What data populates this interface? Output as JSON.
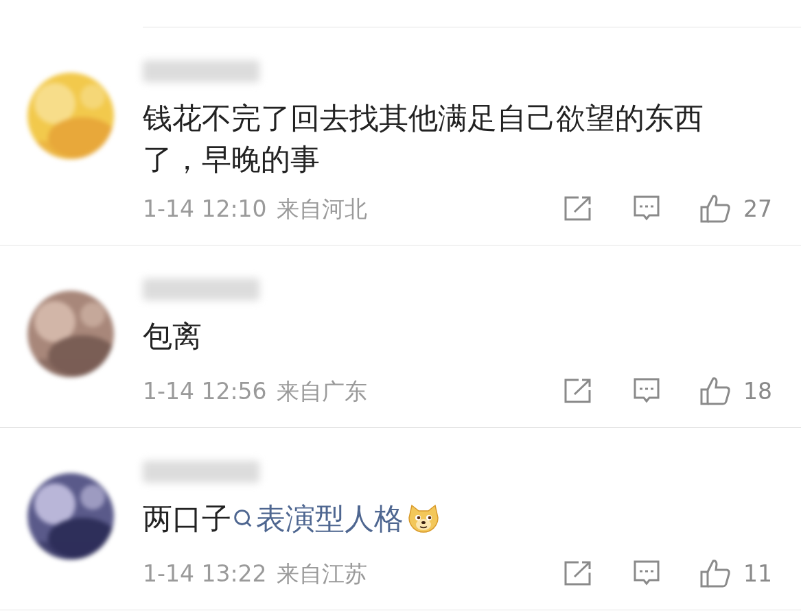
{
  "comments": [
    {
      "body": [
        {
          "kind": "text",
          "text": "钱花不完了回去找其他满足自己欲望的东西了，早晚的事"
        }
      ],
      "time": "1-14 12:10",
      "location": "来自河北",
      "likes": "27"
    },
    {
      "body": [
        {
          "kind": "text",
          "text": "包离"
        }
      ],
      "time": "1-14 12:56",
      "location": "来自广东",
      "likes": "18"
    },
    {
      "body": [
        {
          "kind": "text",
          "text": "两口子"
        },
        {
          "kind": "topic",
          "text": "表演型人格"
        },
        {
          "kind": "emoji"
        }
      ],
      "time": "1-14 13:22",
      "location": "来自江苏",
      "likes": "11"
    }
  ]
}
